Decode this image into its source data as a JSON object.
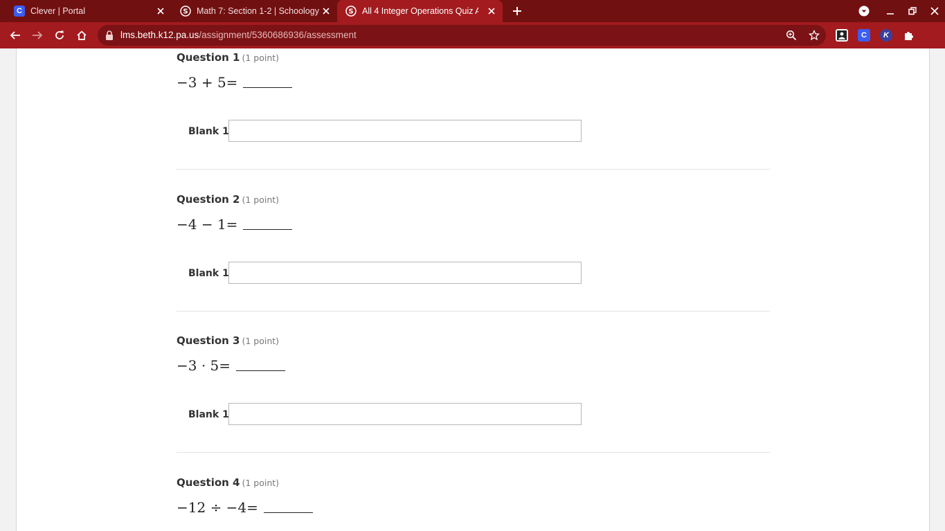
{
  "browser": {
    "tabs": [
      {
        "title": "Clever | Portal",
        "favicon": "clever-icon",
        "active": false
      },
      {
        "title": "Math 7: Section 1-2 | Schoology",
        "favicon": "schoology-icon",
        "active": false
      },
      {
        "title": "All 4 Integer Operations Quiz A |",
        "favicon": "schoology-icon",
        "active": true
      }
    ],
    "url_host": "lms.beth.k12.pa.us",
    "url_path": "/assignment/5360686936/assessment",
    "extensions": [
      "C",
      "K"
    ],
    "colors": {
      "tabstrip": "#711011",
      "toolbar": "#a31b1f",
      "omnibox": "#7b1215",
      "clever_blue": "#3c5df3"
    }
  },
  "questions": [
    {
      "title": "Question 1",
      "points": "(1 point)",
      "expr": "−3 + 5=",
      "blank_label": "Blank 1:",
      "answer": ""
    },
    {
      "title": "Question 2",
      "points": "(1 point)",
      "expr": "−4 − 1=",
      "blank_label": "Blank 1:",
      "answer": ""
    },
    {
      "title": "Question 3",
      "points": "(1 point)",
      "expr": "−3 · 5=",
      "blank_label": "Blank 1:",
      "answer": ""
    },
    {
      "title": "Question 4",
      "points": "(1 point)",
      "expr": "−12 ÷ −4=",
      "blank_label": "Blank 1:",
      "answer": ""
    }
  ]
}
